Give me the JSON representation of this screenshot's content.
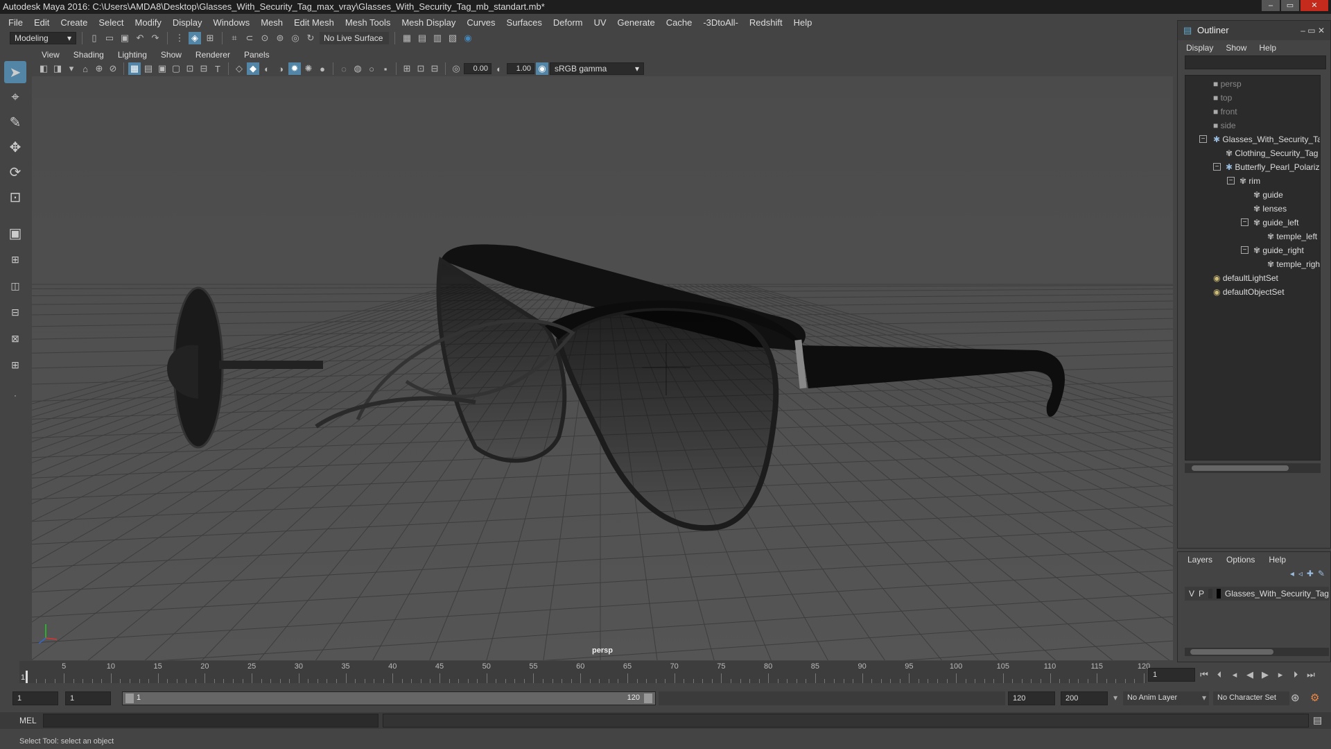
{
  "window": {
    "title": "Autodesk Maya 2016: C:\\Users\\AMDA8\\Desktop\\Glasses_With_Security_Tag_max_vray\\Glasses_With_Security_Tag_mb_standart.mb*"
  },
  "menubar": [
    "File",
    "Edit",
    "Create",
    "Select",
    "Modify",
    "Display",
    "Windows",
    "Mesh",
    "Edit Mesh",
    "Mesh Tools",
    "Mesh Display",
    "Curves",
    "Surfaces",
    "Deform",
    "UV",
    "Generate",
    "Cache",
    "-3DtoAll-",
    "Redshift",
    "Help"
  ],
  "shelf": {
    "mode": "Modeling",
    "live_surface": "No Live Surface"
  },
  "viewport": {
    "menus": [
      "View",
      "Shading",
      "Lighting",
      "Show",
      "Renderer",
      "Panels"
    ],
    "exposure": "0.00",
    "gamma": "1.00",
    "color_space": "sRGB gamma",
    "camera_label": "persp"
  },
  "outliner": {
    "title": "Outliner",
    "menus": [
      "Display",
      "Show",
      "Help"
    ],
    "items": [
      "persp",
      "top",
      "front",
      "side",
      "Glasses_With_Security_Tag",
      "Clothing_Security_Tag",
      "Butterfly_Pearl_Polarized",
      "rim",
      "guide",
      "lenses",
      "guide_left",
      "temple_left",
      "guide_right",
      "temple_right",
      "defaultLightSet",
      "defaultObjectSet"
    ]
  },
  "layers": {
    "menus": [
      "Layers",
      "Options",
      "Help"
    ],
    "row": {
      "v": "V",
      "p": "P",
      "name": "Glasses_With_Security_Tag"
    }
  },
  "timeline": {
    "ticks": [
      "5",
      "10",
      "15",
      "20",
      "25",
      "30",
      "35",
      "40",
      "45",
      "50",
      "55",
      "60",
      "65",
      "70",
      "75",
      "80",
      "85",
      "90",
      "95",
      "100",
      "105",
      "110",
      "115",
      "120"
    ],
    "start_label": "1",
    "current_frame": "1"
  },
  "range": {
    "start": "1",
    "playback_start": "1",
    "slider_start": "1",
    "slider_end": "120",
    "playback_end": "120",
    "end": "200",
    "anim_layer": "No Anim Layer",
    "character_set": "No Character Set"
  },
  "command": {
    "label": "MEL"
  },
  "help_line": "Select Tool: select an object"
}
